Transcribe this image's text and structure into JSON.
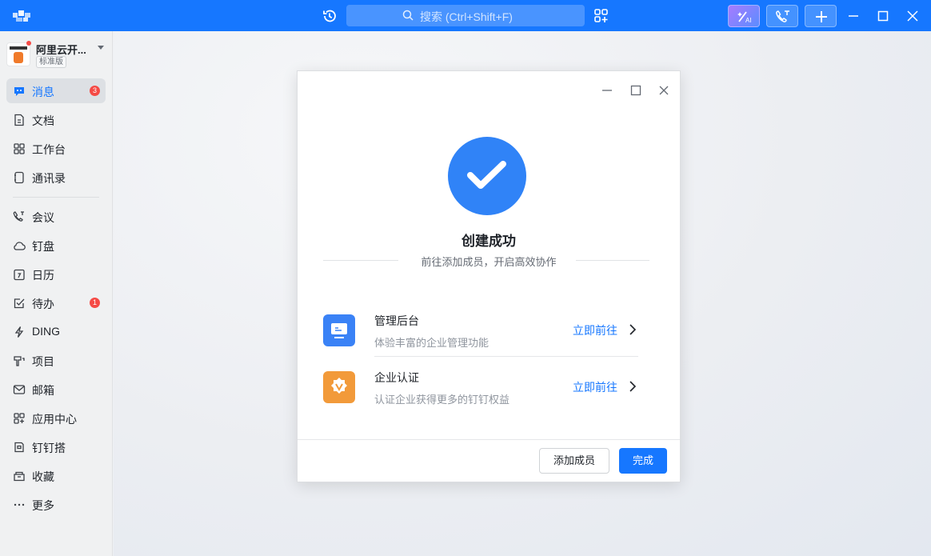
{
  "topbar": {
    "search_placeholder": "搜索 (Ctrl+Shift+F)",
    "icons": [
      "app-logo-icon",
      "history-icon",
      "search-icon",
      "apps-add-icon",
      "ai-icon",
      "call-icon",
      "plus-icon",
      "minimize-icon",
      "maximize-icon",
      "close-icon"
    ],
    "color": "#1677ff"
  },
  "sidebar": {
    "org_name": "阿里云开...",
    "org_badge": "标准版",
    "items": [
      {
        "label": "消息",
        "icon": "message-icon",
        "badge": "3",
        "active": true
      },
      {
        "label": "文档",
        "icon": "document-icon"
      },
      {
        "label": "工作台",
        "icon": "workbench-icon"
      },
      {
        "label": "通讯录",
        "icon": "contacts-icon"
      },
      {
        "label": "会议",
        "icon": "meeting-icon"
      },
      {
        "label": "钉盘",
        "icon": "cloud-drive-icon"
      },
      {
        "label": "日历",
        "icon": "calendar-icon"
      },
      {
        "label": "待办",
        "icon": "todo-icon",
        "badge": "1"
      },
      {
        "label": "DING",
        "icon": "ding-icon"
      },
      {
        "label": "项目",
        "icon": "project-icon"
      },
      {
        "label": "邮箱",
        "icon": "mail-icon"
      },
      {
        "label": "应用中心",
        "icon": "app-center-icon"
      },
      {
        "label": "钉钉搭",
        "icon": "dingda-icon"
      },
      {
        "label": "收藏",
        "icon": "favorites-icon"
      },
      {
        "label": "更多",
        "icon": "more-icon"
      }
    ]
  },
  "dialog": {
    "title": "创建成功",
    "subtitle": "前往添加成员，开启高效协作",
    "options": [
      {
        "title": "管理后台",
        "desc": "体验丰富的企业管理功能",
        "action": "立即前往",
        "icon": "admin-console-icon",
        "color": "#3a82f6"
      },
      {
        "title": "企业认证",
        "desc": "认证企业获得更多的钉钉权益",
        "action": "立即前往",
        "icon": "verify-icon",
        "color": "#f29a3a"
      }
    ],
    "add_member_label": "添加成员",
    "done_label": "完成",
    "accent": "#1677ff",
    "success_color": "#3083f7"
  }
}
